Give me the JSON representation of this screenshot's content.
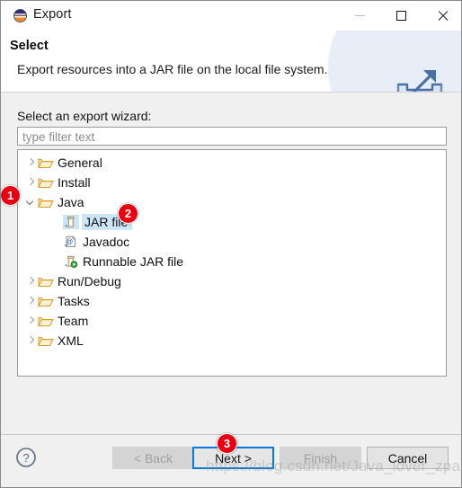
{
  "window": {
    "title": "Export",
    "icon": "eclipse-logo-icon",
    "controls": {
      "minimize": "minimize-icon",
      "maximize": "maximize-icon",
      "close": "close-icon"
    }
  },
  "header": {
    "title": "Select",
    "description": "Export resources into a JAR file on the local file system.",
    "icon": "export-wizard-icon"
  },
  "body": {
    "field_label": "Select an export wizard:",
    "filter": {
      "value": "",
      "placeholder": "type filter text"
    },
    "tree": [
      {
        "label": "General",
        "icon": "folder-icon",
        "depth": 0,
        "state": "collapsed",
        "selected": false
      },
      {
        "label": "Install",
        "icon": "folder-icon",
        "depth": 0,
        "state": "collapsed",
        "selected": false
      },
      {
        "label": "Java",
        "icon": "folder-icon",
        "depth": 0,
        "state": "expanded",
        "selected": false
      },
      {
        "label": "JAR file",
        "icon": "jar-file-icon",
        "depth": 1,
        "state": "leaf",
        "selected": true
      },
      {
        "label": "Javadoc",
        "icon": "javadoc-icon",
        "depth": 1,
        "state": "leaf",
        "selected": false
      },
      {
        "label": "Runnable JAR file",
        "icon": "runnable-jar-icon",
        "depth": 1,
        "state": "leaf",
        "selected": false
      },
      {
        "label": "Run/Debug",
        "icon": "folder-icon",
        "depth": 0,
        "state": "collapsed",
        "selected": false
      },
      {
        "label": "Tasks",
        "icon": "folder-icon",
        "depth": 0,
        "state": "collapsed",
        "selected": false
      },
      {
        "label": "Team",
        "icon": "folder-icon",
        "depth": 0,
        "state": "collapsed",
        "selected": false
      },
      {
        "label": "XML",
        "icon": "folder-icon",
        "depth": 0,
        "state": "collapsed",
        "selected": false
      }
    ]
  },
  "footer": {
    "help_icon": "help-icon",
    "buttons": {
      "back": {
        "label": "< Back",
        "enabled": false,
        "focused": false
      },
      "next": {
        "label": "Next >",
        "enabled": true,
        "focused": true
      },
      "finish": {
        "label": "Finish",
        "enabled": false,
        "focused": false
      },
      "cancel": {
        "label": "Cancel",
        "enabled": true,
        "focused": false
      }
    }
  },
  "annotations": [
    {
      "number": "1",
      "target": "java-tree-node"
    },
    {
      "number": "2",
      "target": "jar-file-tree-node"
    },
    {
      "number": "3",
      "target": "next-button"
    }
  ],
  "watermark": "https://blog.csdn.net/Java_lover_zpark",
  "colors": {
    "badge": "#e60012",
    "focus_border": "#0a78d4",
    "selection": "#cde6f7",
    "folder": "#f0b44a",
    "dialog_bg": "#f0f0f0"
  }
}
